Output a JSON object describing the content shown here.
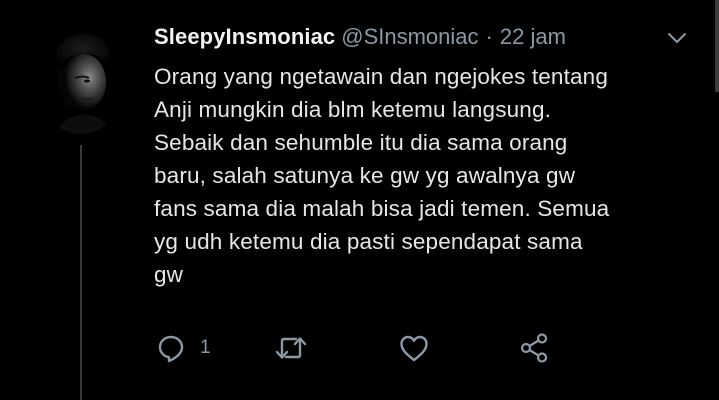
{
  "tweet": {
    "display_name": "SleepyInsmoniac",
    "handle": "@SInsmoniac",
    "separator": "·",
    "time": "22 jam",
    "text": "Orang yang ngetawain dan ngejokes tentang\nAnji mungkin dia blm ketemu langsung.\nSebaik dan sehumble itu dia sama orang\nbaru, salah satunya ke gw yg awalnya gw\nfans sama dia malah bisa jadi temen. Semua\nyg udh ketemu dia pasti sependapat sama\ngw",
    "actions": {
      "reply_count": "1",
      "retweet_count": "",
      "like_count": ""
    }
  },
  "icons": {
    "menu": "chevron-down-icon",
    "reply": "speech-bubble-icon",
    "retweet": "retweet-icon",
    "like": "heart-icon",
    "share": "share-icon"
  },
  "colors": {
    "background": "#000000",
    "text": "#e6e6e6",
    "secondary": "#8b98a5",
    "thread_line": "#3a3a3a"
  }
}
